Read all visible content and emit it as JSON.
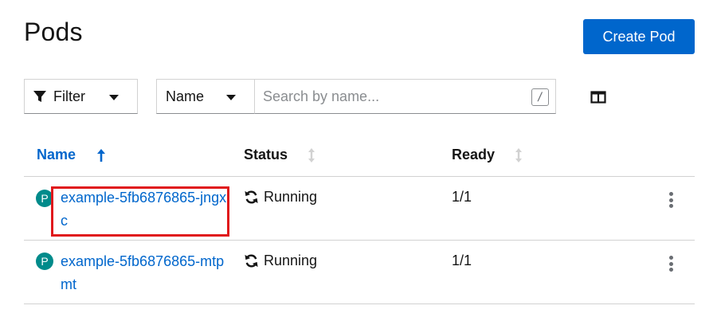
{
  "header": {
    "title": "Pods",
    "create_button": "Create Pod"
  },
  "toolbar": {
    "filter_label": "Filter",
    "name_select": "Name",
    "search_placeholder": "Search by name...",
    "search_shortcut": "/"
  },
  "table": {
    "columns": [
      "Name",
      "Status",
      "Ready"
    ],
    "sorted_column": "Name",
    "rows": [
      {
        "badge": "P",
        "name": "example-5fb6876865-jngxc",
        "status": "Running",
        "ready": "1/1"
      },
      {
        "badge": "P",
        "name": "example-5fb6876865-mtpmt",
        "status": "Running",
        "ready": "1/1"
      }
    ]
  },
  "colors": {
    "primary": "#0066cc",
    "pod_badge": "#008b8b",
    "highlight": "#e0191c"
  },
  "icons": [
    "filter-icon",
    "caret-down-icon",
    "columns-icon",
    "sort-asc-icon",
    "sort-icon",
    "sync-icon",
    "kebab-icon"
  ]
}
